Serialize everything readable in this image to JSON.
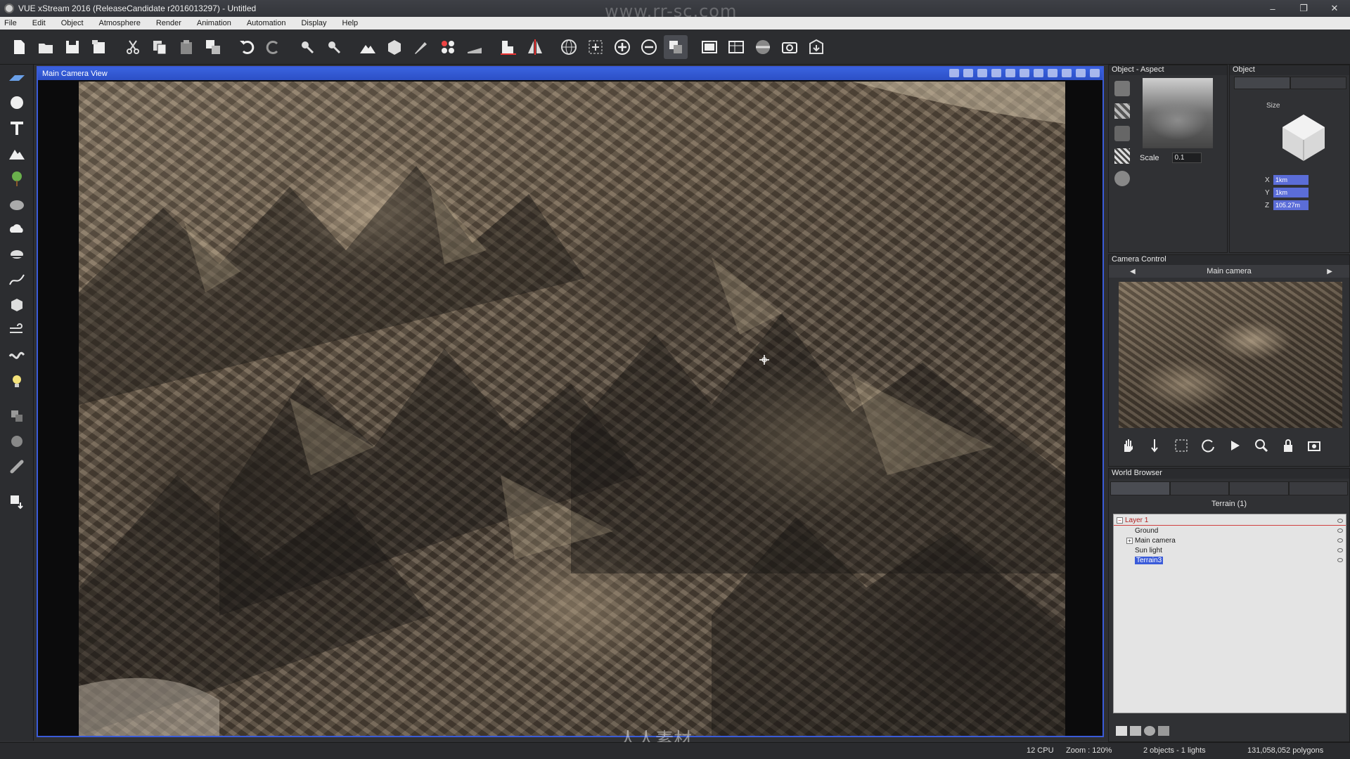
{
  "window": {
    "title": "VUE xStream 2016 (ReleaseCandidate r2016013297) - Untitled",
    "watermark": "www.rr-sc.com",
    "controls": {
      "minimize": "–",
      "restore": "❐",
      "close": "✕"
    }
  },
  "menu": [
    "File",
    "Edit",
    "Object",
    "Atmosphere",
    "Render",
    "Animation",
    "Automation",
    "Display",
    "Help"
  ],
  "toolbar": {
    "buttons": [
      "new-file",
      "open-file",
      "save",
      "save-as",
      "cut",
      "copy",
      "paste",
      "duplicate",
      "undo",
      "redo",
      "select",
      "select-multi",
      "terrain-tool",
      "object-tool",
      "brush-tool",
      "material-tool",
      "render-settings",
      "align",
      "mirror",
      "globe",
      "zoom-fit",
      "zoom-in",
      "zoom-out",
      "toggle-view",
      "render-frame",
      "render-region",
      "atmosphere",
      "camera",
      "export"
    ]
  },
  "leftbar": {
    "tools": [
      "plane",
      "sphere",
      "text",
      "terrain",
      "plant",
      "rock",
      "cloud",
      "water",
      "path",
      "cube",
      "wind",
      "wave",
      "light",
      "move",
      "rotate",
      "link",
      "layer-down"
    ]
  },
  "viewport": {
    "title": "Main Camera View",
    "header_tools": [
      "view-1",
      "view-2",
      "view-3",
      "view-4",
      "z",
      "view-6",
      "view-7",
      "view-8",
      "view-9",
      "view-10",
      "view-11"
    ],
    "bottom_watermark": "人人素材"
  },
  "aspect_panel": {
    "title": "Object - Aspect",
    "scale_label": "Scale",
    "scale_value": "0.1"
  },
  "object_panel": {
    "title": "Object",
    "size_label": "Size",
    "x_label": "X",
    "x_value": "1km",
    "y_label": "Y",
    "y_value": "1km",
    "z_label": "Z",
    "z_value": "105.27m"
  },
  "camera_panel": {
    "title": "Camera Control",
    "camera_name": "Main camera",
    "prev": "◀",
    "next": "▶"
  },
  "world_browser": {
    "title": "World Browser",
    "header": "Terrain (1)",
    "tree": [
      {
        "label": "Layer 1",
        "depth": 0,
        "expander": "−",
        "type": "layer"
      },
      {
        "label": "Ground",
        "depth": 1,
        "expander": "",
        "type": "item"
      },
      {
        "label": "Main camera",
        "depth": 1,
        "expander": "+",
        "type": "item"
      },
      {
        "label": "Sun light",
        "depth": 1,
        "expander": "",
        "type": "item"
      },
      {
        "label": "Terrain3",
        "depth": 1,
        "expander": "",
        "type": "selected"
      }
    ]
  },
  "status": {
    "cpu": "12 CPU",
    "zoom": "Zoom : 120%",
    "objects": "2 objects - 1 lights",
    "polygons": "131,058,052 polygons"
  },
  "colors": {
    "accent": "#3a5bd9",
    "panel_bg": "#303134",
    "toolbar_bg": "#2c2d30"
  }
}
